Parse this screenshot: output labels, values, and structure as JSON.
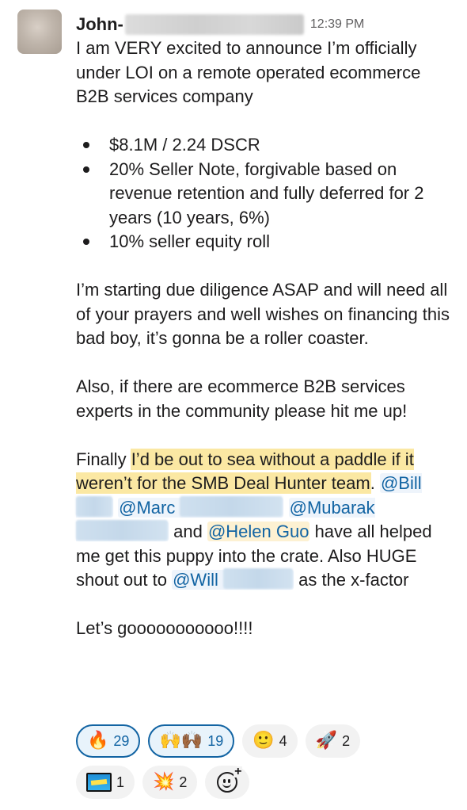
{
  "message": {
    "author": "John-",
    "timestamp": "12:39 PM",
    "intro": "I am VERY excited to announce I’m officially under LOI on a remote operated ecommerce B2B services company",
    "bullets": [
      "$8.1M / 2.24 DSCR",
      "20% Seller Note, forgivable based on revenue retention and fully deferred for 2 years (10 years, 6%)",
      "10% seller equity roll"
    ],
    "para2": "I’m starting due diligence ASAP and will need all of your prayers and well wishes on financing this bad boy, it’s gonna be a roller coaster.",
    "para3": "Also, if there are ecommerce B2B services experts in the community please hit me up!",
    "para4": {
      "lead": "Finally ",
      "highlight": "I’d be out to sea without a paddle if it weren’t for the SMB Deal Hunter team",
      "dot": ". ",
      "mention_bill": "@Bill",
      "mention_marc": "@Marc",
      "mention_mubarak": "@Mubarak",
      "and": " and ",
      "mention_helen": "@Helen Guo",
      "mid": " have all helped me get this puppy into the crate. Also HUGE shout out to ",
      "mention_will": "@Will",
      "tail": " as the x-factor"
    },
    "closing": "Let’s gooooooooooo!!!!"
  },
  "reactions": [
    {
      "emoji": "🔥",
      "count": "29",
      "mine": true
    },
    {
      "emoji": "🙌🙌🏾",
      "count": "19",
      "mine": true
    },
    {
      "emoji": "🙂",
      "count": "4",
      "mine": false
    },
    {
      "emoji": "🚀",
      "count": "2",
      "mine": false
    },
    {
      "emoji": "awesome",
      "count": "1",
      "mine": false
    },
    {
      "emoji": "💥",
      "count": "2",
      "mine": false
    }
  ],
  "icons": {
    "add_reaction": "add-reaction-icon"
  }
}
